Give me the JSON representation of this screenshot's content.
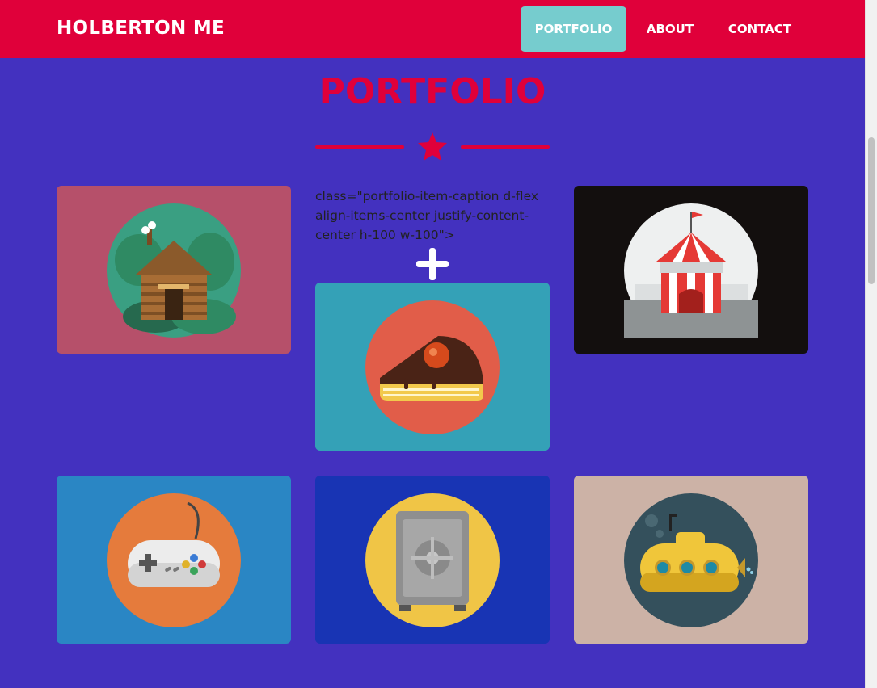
{
  "navbar": {
    "brand": "HOLBERTON ME",
    "items": [
      {
        "label": "PORTFOLIO",
        "active": true
      },
      {
        "label": "ABOUT",
        "active": false
      },
      {
        "label": "CONTACT",
        "active": false
      }
    ]
  },
  "section": {
    "title": "PORTFOLIO",
    "icon": "star-icon"
  },
  "caption": {
    "raw_text": "class=\"portfolio-item-caption d-flex align-items-center justify-content-center h-100 w-100\">",
    "icon": "plus-icon"
  },
  "portfolio_items": [
    {
      "icon": "cabin-icon",
      "background": "#b6506a",
      "circle": "#3a9f82"
    },
    {
      "icon": "cake-icon",
      "background": "#34a1b7",
      "circle": "#e15d49"
    },
    {
      "icon": "circus-tent-icon",
      "background": "#130f0e",
      "circle": "#eef0f0"
    },
    {
      "icon": "game-controller-icon",
      "background": "#2a86c4",
      "circle": "#e57b3c"
    },
    {
      "icon": "safe-icon",
      "background": "#1834b4",
      "circle": "#f0c546"
    },
    {
      "icon": "submarine-icon",
      "background": "#ccb2a6",
      "circle": "#34505c"
    }
  ],
  "colors": {
    "page_background": "#4331bf",
    "navbar": "#e0003a",
    "active_nav": "#76ccce",
    "accent": "#e0003a"
  }
}
